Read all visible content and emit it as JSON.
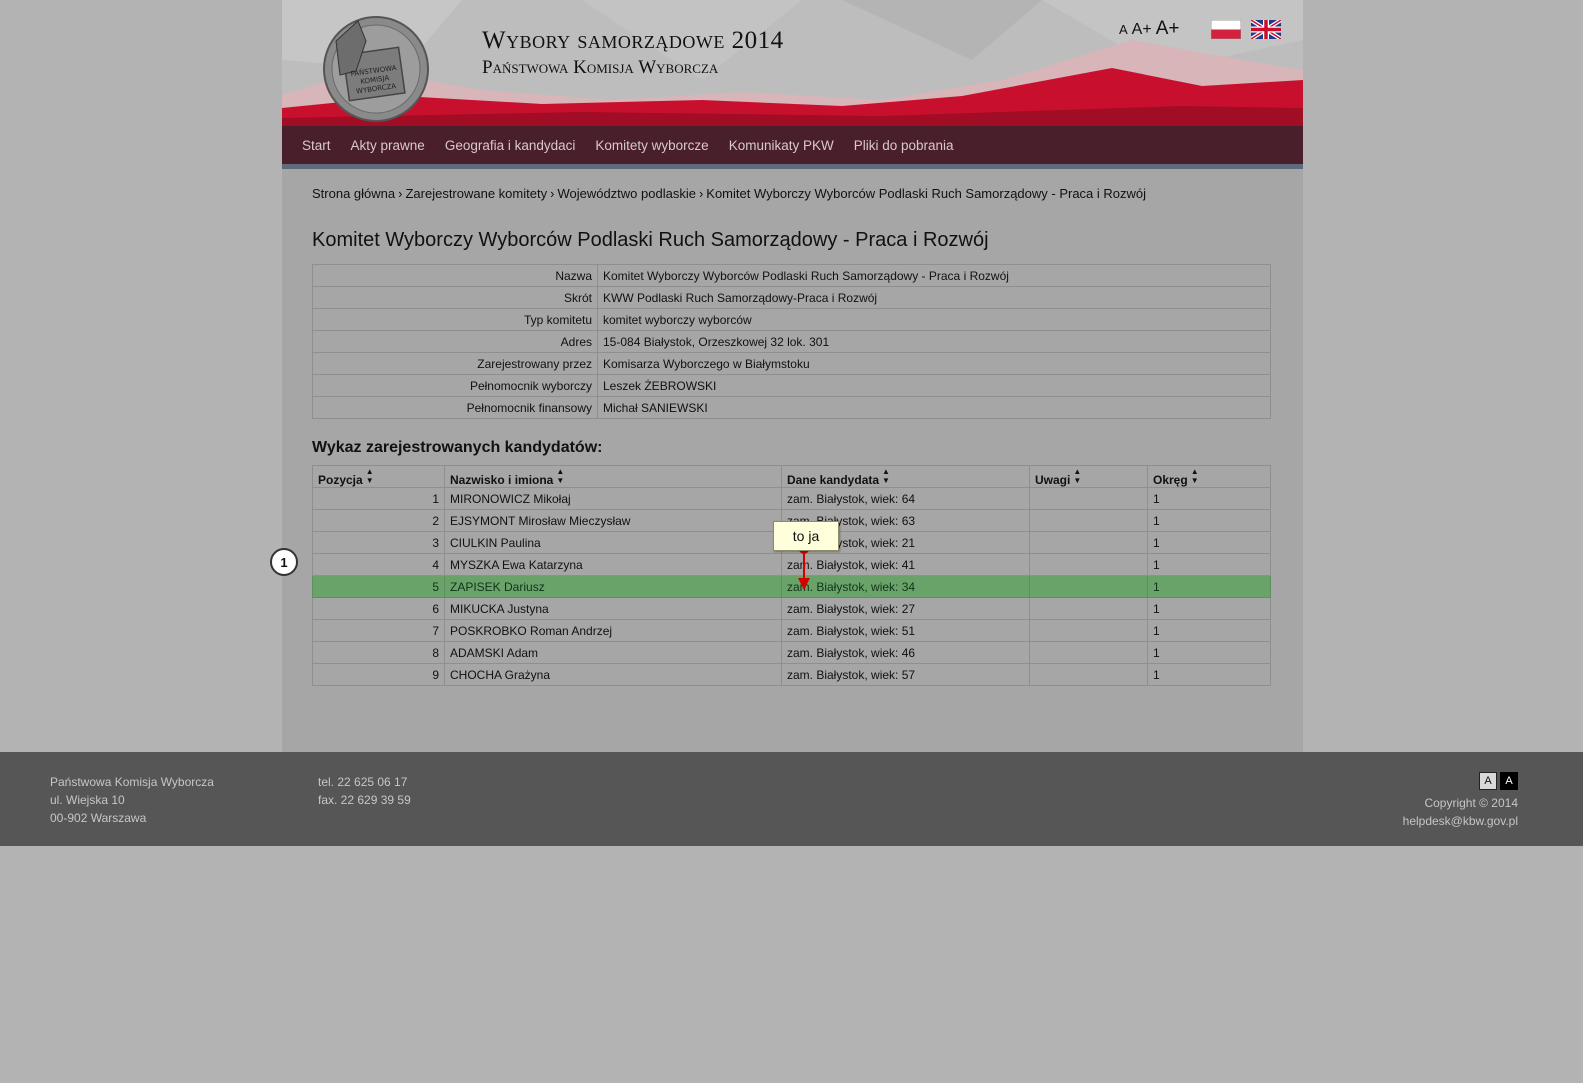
{
  "header": {
    "title": "Wybory samorządowe 2014",
    "subtitle": "Państwowa Komisja Wyborcza",
    "logo_lines": [
      "PAŃSTWOWA",
      "KOMISJA",
      "WYBORCZA"
    ],
    "font_sizes": [
      "A",
      "A+",
      "A+"
    ]
  },
  "nav": {
    "items": [
      "Start",
      "Akty prawne",
      "Geografia i kandydaci",
      "Komitety wyborcze",
      "Komunikaty PKW",
      "Pliki do pobrania"
    ]
  },
  "breadcrumb": {
    "items": [
      "Strona główna",
      "Zarejestrowane komitety",
      "Województwo podlaskie",
      "Komitet Wyborczy Wyborców Podlaski Ruch Samorządowy - Praca i Rozwój"
    ],
    "separator": "›"
  },
  "page_title": "Komitet Wyborczy Wyborców Podlaski Ruch Samorządowy - Praca i Rozwój",
  "info": [
    {
      "key": "Nazwa",
      "value": "Komitet Wyborczy Wyborców Podlaski Ruch Samorządowy - Praca i Rozwój"
    },
    {
      "key": "Skrót",
      "value": "KWW Podlaski Ruch Samorządowy-Praca i Rozwój"
    },
    {
      "key": "Typ komitetu",
      "value": "komitet wyborczy wyborców"
    },
    {
      "key": "Adres",
      "value": "15-084 Białystok, Orzeszkowej 32 lok. 301"
    },
    {
      "key": "Zarejestrowany przez",
      "value": "Komisarza Wyborczego w Białymstoku"
    },
    {
      "key": "Pełnomocnik wyborczy",
      "value": "Leszek ŻEBROWSKI"
    },
    {
      "key": "Pełnomocnik finansowy",
      "value": "Michał SANIEWSKI"
    }
  ],
  "candidates": {
    "title": "Wykaz zarejestrowanych kandydatów:",
    "columns": [
      "Pozycja",
      "Nazwisko i imiona",
      "Dane kandydata",
      "Uwagi",
      "Okręg"
    ],
    "rows": [
      {
        "pos": "1",
        "name": "MIRONOWICZ Mikołaj",
        "data": "zam. Białystok, wiek: 64",
        "notes": "",
        "district": "1"
      },
      {
        "pos": "2",
        "name": "EJSYMONT Mirosław Mieczysław",
        "data": "zam. Białystok, wiek: 63",
        "notes": "",
        "district": "1"
      },
      {
        "pos": "3",
        "name": "CIULKIN Paulina",
        "data": "zam. Białystok, wiek: 21",
        "notes": "",
        "district": "1"
      },
      {
        "pos": "4",
        "name": "MYSZKA Ewa Katarzyna",
        "data": "zam. Białystok, wiek: 41",
        "notes": "",
        "district": "1"
      },
      {
        "pos": "5",
        "name": "ZAPISEK Dariusz",
        "data": "zam. Białystok, wiek: 34",
        "notes": "",
        "district": "1",
        "highlighted": true
      },
      {
        "pos": "6",
        "name": "MIKUCKA Justyna",
        "data": "zam. Białystok, wiek: 27",
        "notes": "",
        "district": "1"
      },
      {
        "pos": "7",
        "name": "POSKROBKO Roman Andrzej",
        "data": "zam. Białystok, wiek: 51",
        "notes": "",
        "district": "1"
      },
      {
        "pos": "8",
        "name": "ADAMSKI Adam",
        "data": "zam. Białystok, wiek: 46",
        "notes": "",
        "district": "1"
      },
      {
        "pos": "9",
        "name": "CHOCHA Grażyna",
        "data": "zam. Białystok, wiek: 57",
        "notes": "",
        "district": "1"
      }
    ]
  },
  "annotations": {
    "note_text": "to ja",
    "marker_label": "1",
    "highlight_color": "#6aa369",
    "arrow_color": "#d40000"
  },
  "footer": {
    "org": "Państwowa Komisja Wyborcza",
    "street": "ul. Wiejska 10",
    "city": "00-902 Warszawa",
    "tel": "tel. 22 625 06 17",
    "fax": "fax. 22 629 39 59",
    "contrast_labels": [
      "A",
      "A"
    ],
    "copyright": "Copyright © 2014",
    "email": "helpdesk@kbw.gov.pl"
  },
  "colors": {
    "nav_bg": "#4a1f2c",
    "header_red": "#c8102e",
    "footer_bg": "#565656"
  }
}
